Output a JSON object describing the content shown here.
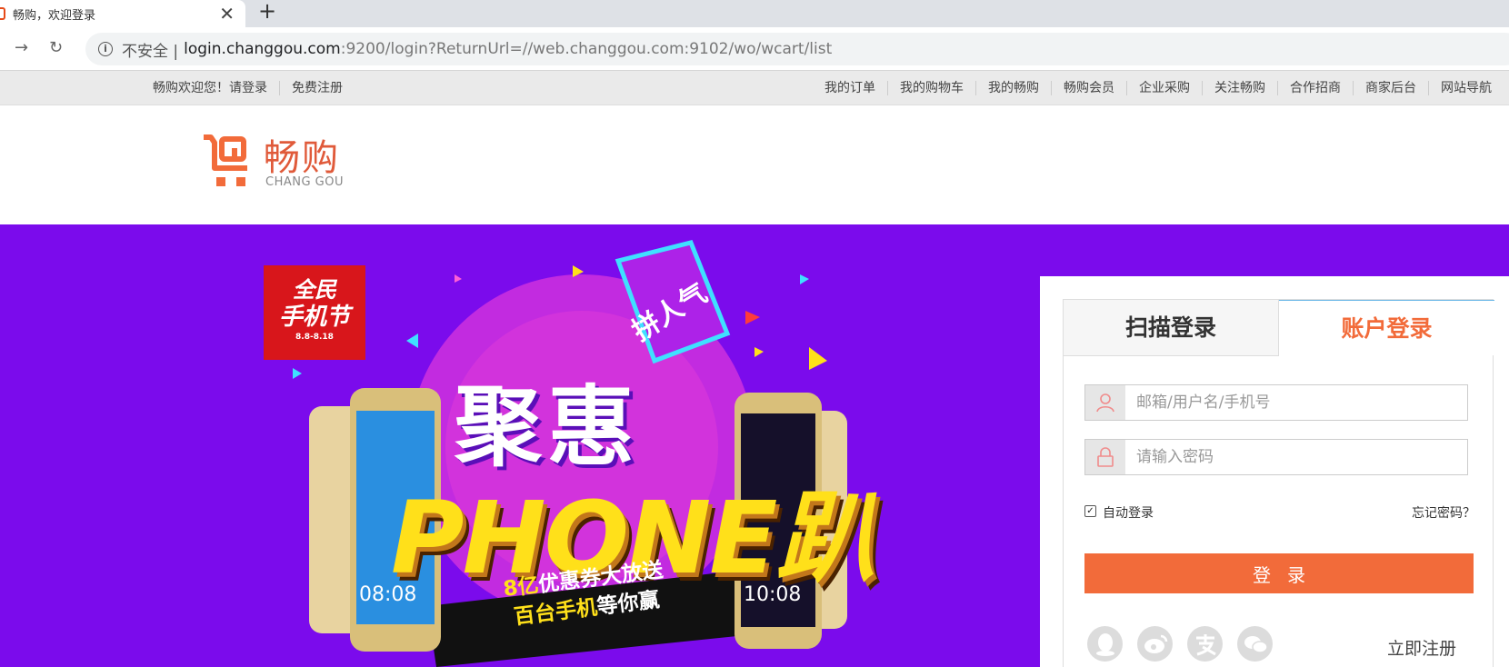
{
  "browser": {
    "tab_title": "畅购，欢迎登录",
    "close_glyph": "✕",
    "new_tab_glyph": "+",
    "url_security": "不安全 |",
    "url_host": "login.changgou.com",
    "url_rest": ":9200/login?ReturnUrl=//web.changgou.com:9102/wo/wcart/list"
  },
  "topbar": {
    "welcome": "畅购欢迎您！请登录",
    "register": "免费注册",
    "links": [
      "我的订单",
      "我的购物车",
      "我的畅购",
      "畅购会员",
      "企业采购",
      "关注畅购",
      "合作招商",
      "商家后台",
      "网站导航"
    ]
  },
  "logo": {
    "name_cn": "畅购",
    "name_en": "CHANG GOU",
    "color": "#e05a3a"
  },
  "banner": {
    "badge_line1": "全民",
    "badge_line2": "手机节",
    "badge_line3": "8.8-8.18",
    "tag": "拼人气",
    "headline": "聚惠",
    "phone_word": "PHONE趴",
    "ribbon_line1_a": "8亿",
    "ribbon_line1_b": "优惠券大放送",
    "ribbon_line2_a": "百台手机",
    "ribbon_line2_b": "等你赢",
    "phone_time_left": "08:08",
    "phone_time_right": "10:08",
    "bg_color": "#7b0bec"
  },
  "login": {
    "tab_qr": "扫描登录",
    "tab_account": "账户登录",
    "username_placeholder": "邮箱/用户名/手机号",
    "password_placeholder": "请输入密码",
    "remember_label": "自动登录",
    "remember_checked": true,
    "forgot": "忘记密码？",
    "submit": "登录",
    "register": "立即注册",
    "social_icons": [
      "qq-icon",
      "weibo-icon",
      "alipay-icon",
      "wechat-icon"
    ],
    "accent_color": "#f26b3a"
  }
}
